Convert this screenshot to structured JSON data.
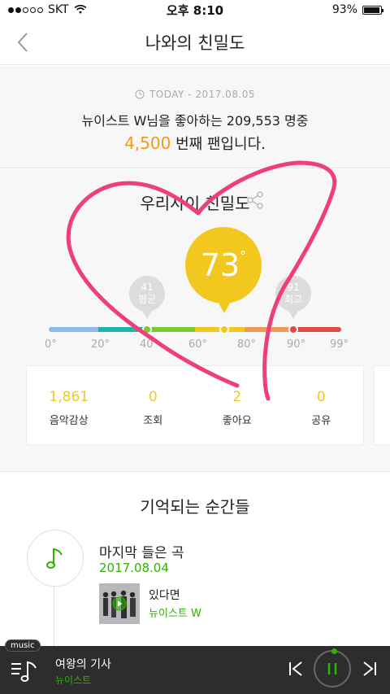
{
  "status_bar": {
    "carrier": "SKT",
    "time": "오후 8:10",
    "battery": "93%",
    "battery_level": 0.93
  },
  "nav": {
    "title": "나와의 친밀도",
    "back_icon": "chevron-left-icon"
  },
  "today": {
    "label": "TODAY - 2017.08.05",
    "fan_text": "뉴이스트 W님을 좋아하는 209,553 명중",
    "rank": "4,500",
    "rank_suffix": "번째 팬입니다."
  },
  "intimacy": {
    "title": "우리사이 친밀도",
    "my_value": "73",
    "my_value_level": 73,
    "degree": "°",
    "avg_value": "41",
    "avg_label": "평균",
    "top_value": "91",
    "top_label": "최고",
    "ticks": [
      "0°",
      "20°",
      "40°",
      "60°",
      "80°",
      "90°",
      "99°"
    ]
  },
  "stats": [
    {
      "value": "1,861",
      "label": "음악감상"
    },
    {
      "value": "0",
      "label": "조회"
    },
    {
      "value": "2",
      "label": "좋아요"
    },
    {
      "value": "0",
      "label": "공유"
    }
  ],
  "memories": {
    "title": "기억되는 순간들",
    "item_label": "마지막 들은 곡",
    "item_date": "2017.08.04",
    "song_title": "있다면",
    "song_artist": "뉴이스트 W"
  },
  "player": {
    "tag": "music",
    "title": "여왕의 기사",
    "artist": "뉴이스트"
  },
  "colors": {
    "accent_green": "#2db400",
    "intimacy_yellow": "#f2c81e",
    "rank_orange": "#f39c12",
    "annotation_pink": "#ee3f7a"
  }
}
